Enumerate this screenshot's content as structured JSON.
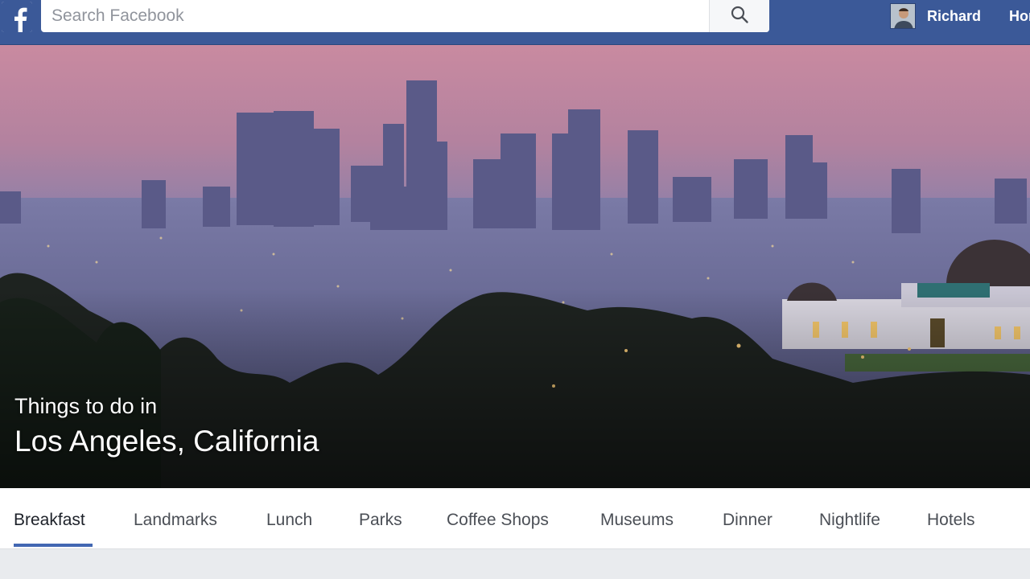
{
  "header": {
    "search_placeholder": "Search Facebook",
    "profile_name": "Richard",
    "home_label": "Home"
  },
  "cover": {
    "subtitle": "Things to do in",
    "title": "Los Angeles, California"
  },
  "tabs": [
    {
      "label": "Breakfast",
      "active": true
    },
    {
      "label": "Landmarks",
      "active": false
    },
    {
      "label": "Lunch",
      "active": false
    },
    {
      "label": "Parks",
      "active": false
    },
    {
      "label": "Coffee Shops",
      "active": false
    },
    {
      "label": "Museums",
      "active": false
    },
    {
      "label": "Dinner",
      "active": false
    },
    {
      "label": "Nightlife",
      "active": false
    },
    {
      "label": "Hotels",
      "active": false
    }
  ],
  "colors": {
    "brand": "#3b5998",
    "active_tab_indicator": "#4267b2"
  }
}
